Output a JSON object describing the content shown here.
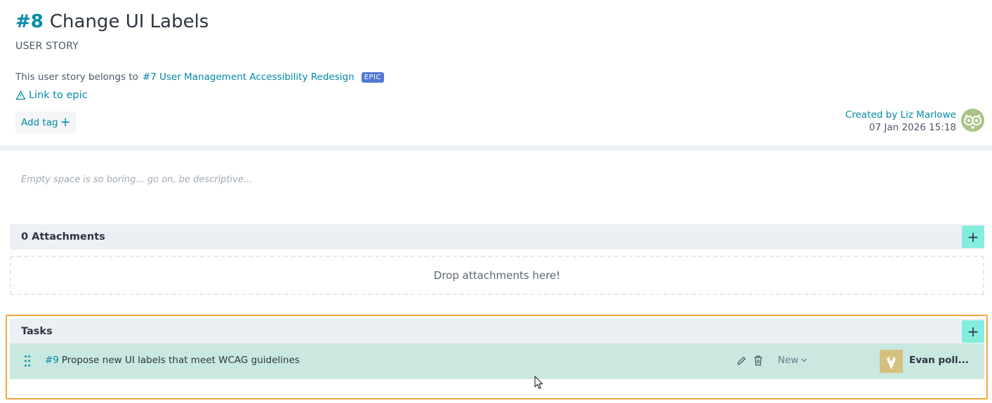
{
  "header": {
    "ref": "#8",
    "subject": "Change UI Labels",
    "type": "USER STORY",
    "belongs_prefix": "This user story belongs to",
    "epic_link": "#7 User Management Accessibility Redesign",
    "epic_badge": "EPIC",
    "link_to_epic": "Link to epic",
    "add_tag": "Add tag"
  },
  "created": {
    "by_prefix": "Created by",
    "author": "Liz Marlowe",
    "date": "07 Jan 2026 15:18"
  },
  "description": {
    "placeholder": "Empty space is so boring... go on, be descriptive..."
  },
  "attachments": {
    "title": "0 Attachments",
    "add": "+",
    "drop_text": "Drop attachments here!"
  },
  "tasks": {
    "title": "Tasks",
    "add": "+",
    "items": [
      {
        "ref": "#9",
        "subject": "Propose new UI labels that meet WCAG guidelines",
        "status": "New",
        "assignee": "Evan poll..."
      }
    ]
  },
  "colors": {
    "accent": "#008aa8",
    "add_button": "#83eede",
    "task_row": "#c8e8e0",
    "highlight_frame": "#f2a83a",
    "epic_badge": "#5178d3"
  },
  "icons": {
    "link": "triangle-link-icon",
    "drag": "drag-handle-icon",
    "edit": "pencil-icon",
    "delete": "trash-icon",
    "status": "chevron-down-icon"
  }
}
